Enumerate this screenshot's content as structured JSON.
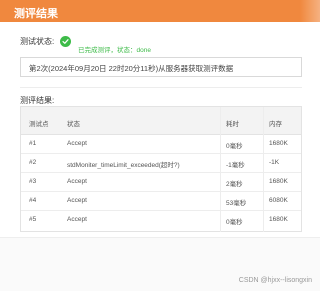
{
  "header": {
    "title": "测评结果"
  },
  "status": {
    "label": "测试状态:",
    "icon": "check-circle-icon",
    "text": "已完成测评，状态：done",
    "color": "#3dbb48"
  },
  "info": {
    "message": "第2次(2024年09月20日 22时20分11秒)从服务器获取测评数据"
  },
  "results": {
    "label": "测评结果:",
    "columns": [
      "测试点",
      "状态",
      "耗时",
      "内存"
    ],
    "rows": [
      {
        "point": "#1",
        "status": "Accept",
        "time": "0毫秒",
        "memory": "1680K"
      },
      {
        "point": "#2",
        "status": "stdMoniter_timeLimit_exceeded(超时?)",
        "time": "-1毫秒",
        "memory": "-1K"
      },
      {
        "point": "#3",
        "status": "Accept",
        "time": "2毫秒",
        "memory": "1680K"
      },
      {
        "point": "#4",
        "status": "Accept",
        "time": "53毫秒",
        "memory": "6080K"
      },
      {
        "point": "#5",
        "status": "Accept",
        "time": "0毫秒",
        "memory": "1680K"
      }
    ]
  },
  "watermark": "CSDN @hjxx--lisongxin",
  "colors": {
    "accent": "#f0883e",
    "success": "#3dbb48"
  }
}
